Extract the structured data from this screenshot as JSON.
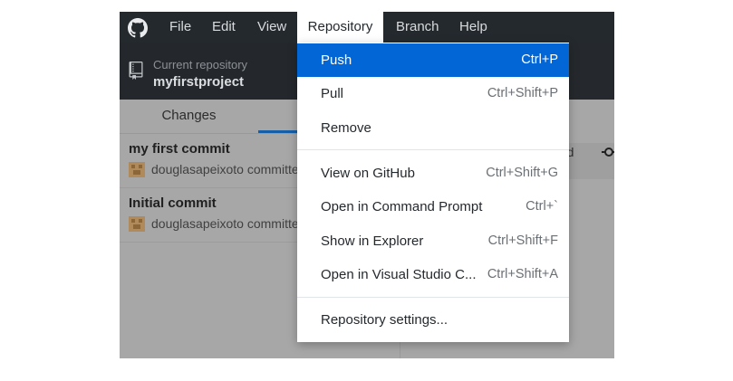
{
  "menubar": {
    "items": [
      {
        "label": "File"
      },
      {
        "label": "Edit"
      },
      {
        "label": "View"
      },
      {
        "label": "Repository"
      },
      {
        "label": "Branch"
      },
      {
        "label": "Help"
      }
    ],
    "active_item": "Repository"
  },
  "toolbar": {
    "repo_caption": "Current repository",
    "repo_name": "myfirstproject"
  },
  "sidebar": {
    "tabs": [
      {
        "label": "Changes"
      },
      {
        "label": ""
      }
    ],
    "commits": [
      {
        "title": "my first commit",
        "meta": "douglasapeixoto committed"
      },
      {
        "title": "Initial commit",
        "meta": "douglasapeixoto committed"
      }
    ]
  },
  "detail": {
    "partial_text": "tted"
  },
  "dropdown": {
    "groups": [
      [
        {
          "label": "Push",
          "shortcut": "Ctrl+P",
          "selected": true
        },
        {
          "label": "Pull",
          "shortcut": "Ctrl+Shift+P"
        },
        {
          "label": "Remove",
          "shortcut": ""
        }
      ],
      [
        {
          "label": "View on GitHub",
          "shortcut": "Ctrl+Shift+G"
        },
        {
          "label": "Open in Command Prompt",
          "shortcut": "Ctrl+`"
        },
        {
          "label": "Show in Explorer",
          "shortcut": "Ctrl+Shift+F"
        },
        {
          "label": "Open in Visual Studio C...",
          "shortcut": "Ctrl+Shift+A"
        }
      ],
      [
        {
          "label": "Repository settings...",
          "shortcut": ""
        }
      ]
    ]
  },
  "colors": {
    "menubar_bg": "#24292e",
    "selection": "#0366d6",
    "tab_accent": "#155ea8"
  }
}
